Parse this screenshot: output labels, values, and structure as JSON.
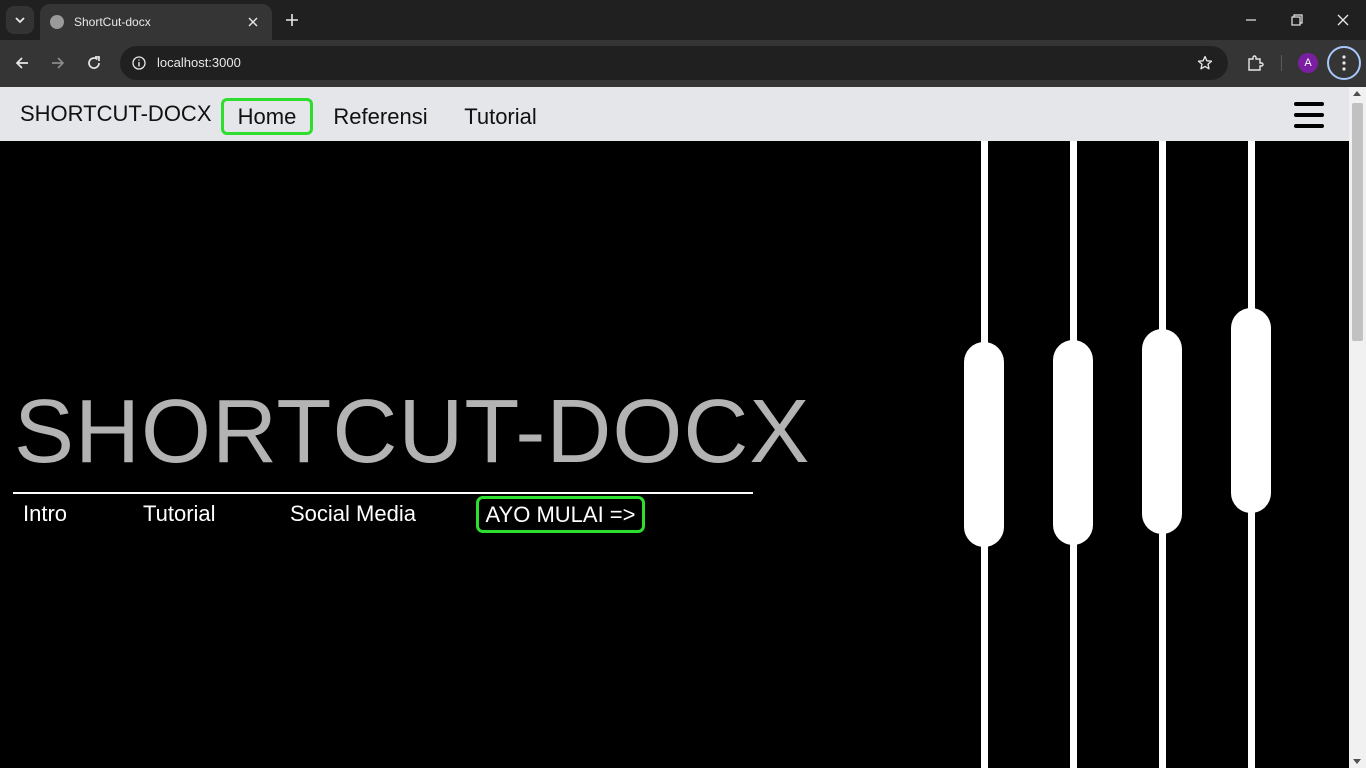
{
  "browser": {
    "tab_title": "ShortCut-docx",
    "url": "localhost:3000",
    "profile_initial": "A",
    "accent_color": "#a8c7fa"
  },
  "site": {
    "brand": "SHORTCUT-DOCX",
    "nav": [
      {
        "label": "Home",
        "active": true
      },
      {
        "label": "Referensi",
        "active": false
      },
      {
        "label": "Tutorial",
        "active": false
      }
    ],
    "highlight_color": "#2ede2e"
  },
  "hero": {
    "title": "SHORTCUT-DOCX",
    "links": [
      "Intro",
      "Tutorial",
      "Social Media"
    ],
    "cta": "AYO MULAI =>"
  },
  "icons": [
    "tab-list-icon",
    "globe-icon",
    "close-icon",
    "plus-icon",
    "minimize-icon",
    "restore-icon",
    "back-icon",
    "forward-icon",
    "reload-icon",
    "info-icon",
    "star-icon",
    "puzzle-icon",
    "more-vert-icon",
    "hamburger-icon"
  ]
}
